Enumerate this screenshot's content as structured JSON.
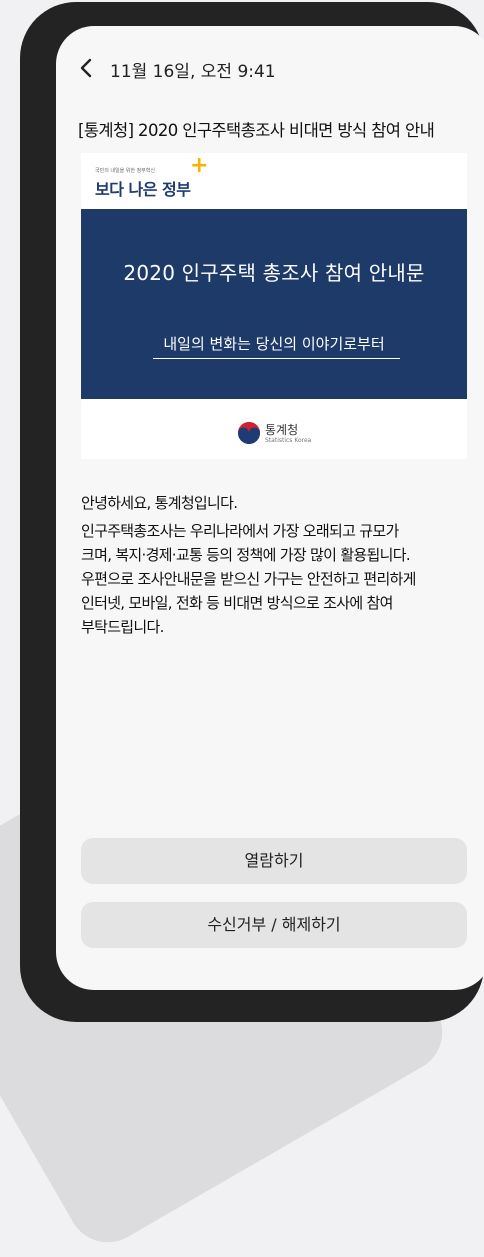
{
  "header": {
    "datetime": "11월 16일, 오전 9:41"
  },
  "message": {
    "subject": "[통계청] 2020 인구주택총조사 비대면 방식 참여 안내",
    "card": {
      "gov_tagline": "국민의 내일을 위한 정부혁신",
      "gov_name": "보다 나은 정부",
      "banner_title": "2020 인구주택 총조사 참여 안내문",
      "banner_subtitle": "내일의 변화는 당신의 이야기로부터",
      "org_name": "통계청",
      "org_name_en": "Statistics Korea"
    },
    "body": {
      "greeting": "안녕하세요, 통계청입니다.",
      "lines": [
        "인구주택총조사는 우리나라에서 가장 오래되고 규모가",
        "크며, 복지·경제·교통 등의 정책에 가장 많이 활용됩니다.",
        "우편으로 조사안내문을 받으신 가구는 안전하고 편리하게",
        "인터넷, 모바일, 전화 등 비대면 방식으로 조사에 참여",
        "부탁드립니다."
      ]
    }
  },
  "actions": {
    "view_label": "열람하기",
    "reject_label": "수신거부 / 해제하기"
  },
  "colors": {
    "banner_bg": "#1e3a68",
    "gov_accent": "#f4b400",
    "button_bg": "#e4e4e4"
  }
}
